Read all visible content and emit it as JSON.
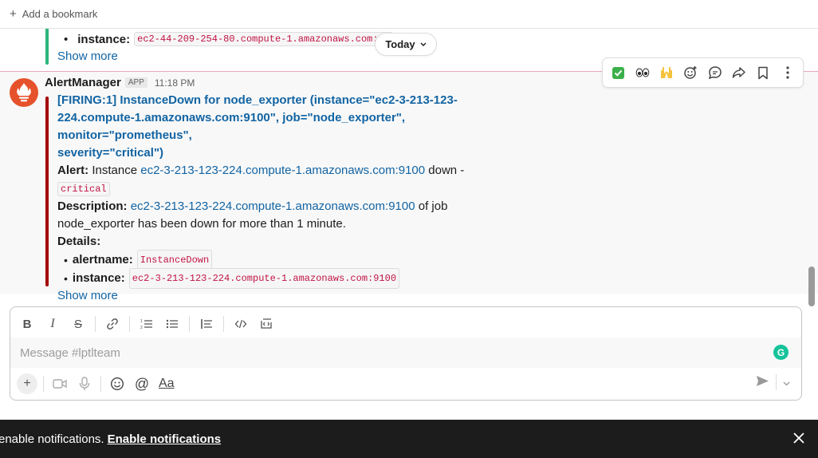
{
  "bookmark_bar": {
    "add_label": "Add a bookmark"
  },
  "previous_message": {
    "instance_key": "instance:",
    "instance_value": "ec2-44-209-254-80.compute-1.amazonaws.com:91",
    "show_more": "Show more"
  },
  "date_divider": {
    "label": "Today"
  },
  "message": {
    "sender": "AlertManager",
    "app_badge": "APP",
    "time": "11:18 PM",
    "title_lines": [
      "[FIRING:1] InstanceDown for node_exporter (instance=\"ec2-3-213-123-",
      "224.compute-1.amazonaws.com:9100\", job=\"node_exporter\", monitor=\"prometheus\",",
      "severity=\"critical\")"
    ],
    "alert_label": "Alert:",
    "alert_text_pre": "Instance",
    "alert_link": "ec2-3-213-123-224.compute-1.amazonaws.com:9100",
    "alert_text_post": "down -",
    "severity_code": "critical",
    "description_label": "Description:",
    "description_link": "ec2-3-213-123-224.compute-1.amazonaws.com:9100",
    "description_post": "of job",
    "description_line2": "node_exporter has been down for more than 1 minute.",
    "details_label": "Details:",
    "details": [
      {
        "key": "alertname:",
        "value": "InstanceDown"
      },
      {
        "key": "instance:",
        "value": "ec2-3-213-123-224.compute-1.amazonaws.com:9100"
      }
    ],
    "show_more": "Show more"
  },
  "message_actions": [
    "check-mark-emoji",
    "eyes-emoji",
    "raised-hands-emoji",
    "add-reaction-icon",
    "reply-thread-icon",
    "forward-icon",
    "bookmark-icon",
    "more-icon"
  ],
  "composer": {
    "placeholder": "Message #lptlteam",
    "grammarly_letter": "G",
    "format_label": "Aa"
  },
  "notification_banner": {
    "text": "enable notifications.",
    "link": "Enable notifications"
  },
  "colors": {
    "link": "#1264a3",
    "alert_bar": "#a30200",
    "prev_bar": "#2eb67d",
    "code_text": "#c01343",
    "banner_bg": "#1d1c1d",
    "prometheus_orange": "#e6522c"
  }
}
